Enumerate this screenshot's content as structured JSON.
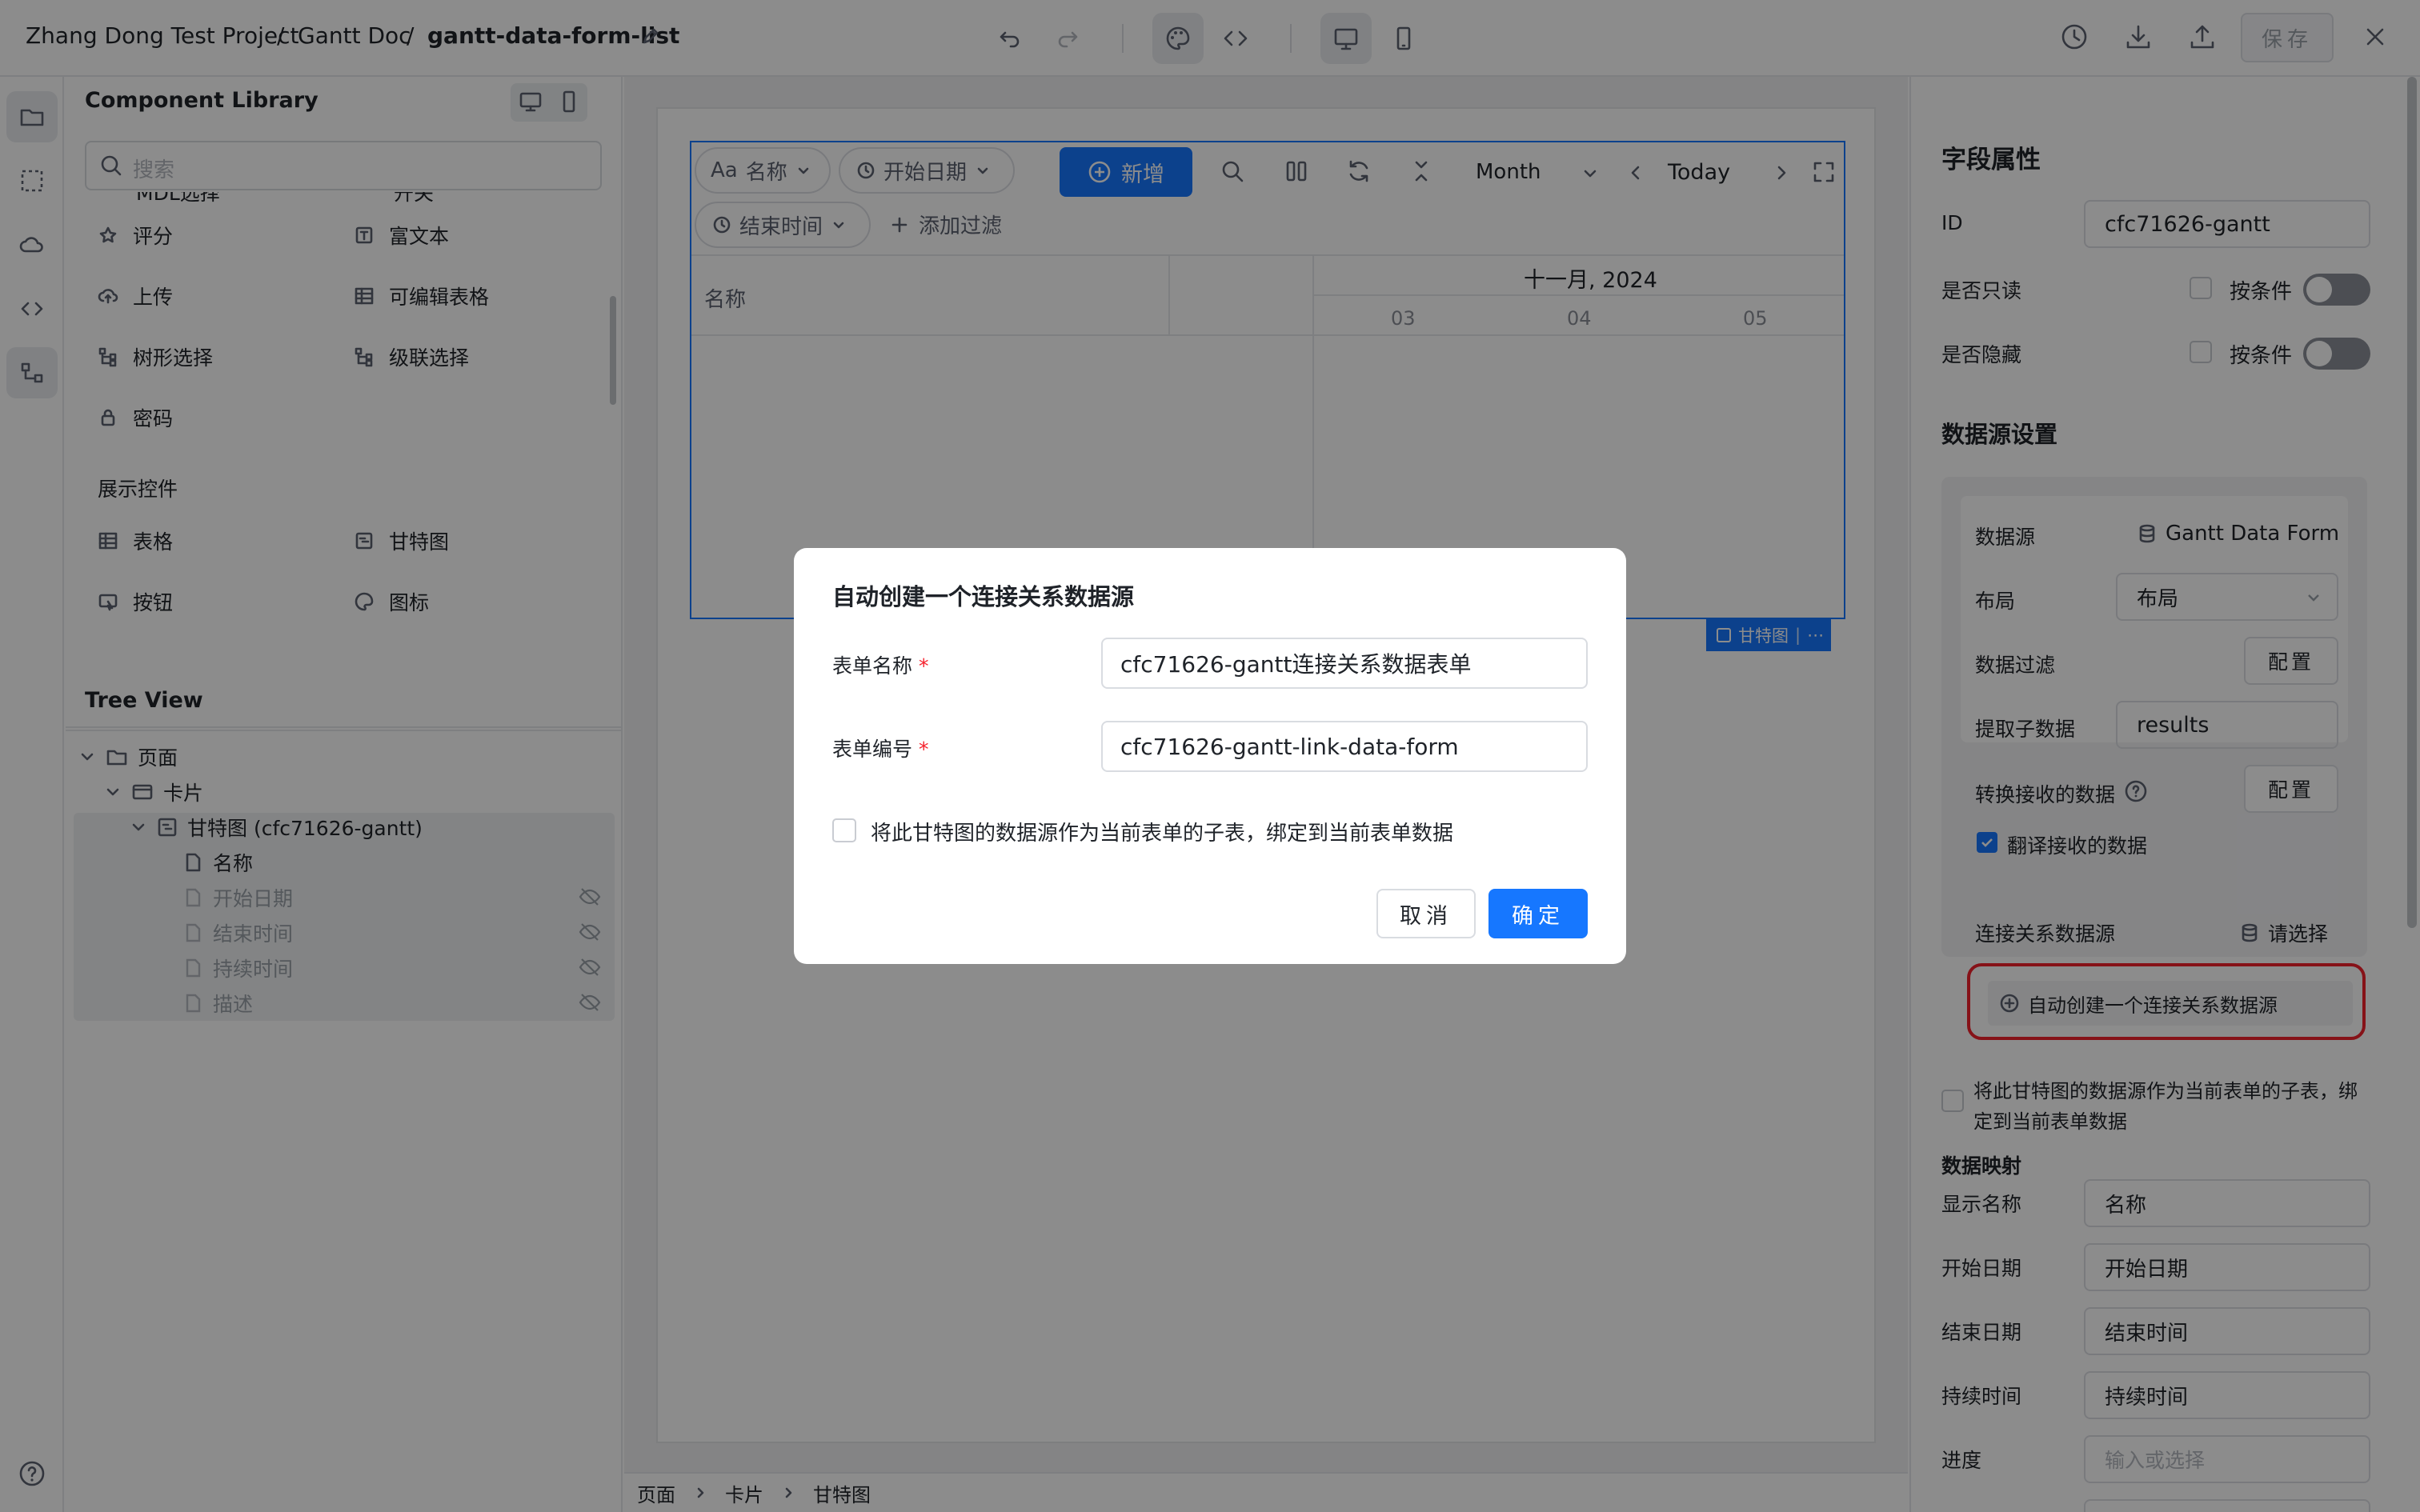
{
  "breadcrumb": {
    "project": "Zhang Dong Test Project",
    "sep1": "/",
    "doc": "Gantt Doc",
    "sep2": "/",
    "page": "gantt-data-form-list"
  },
  "toolbar": {
    "save_label": "保存"
  },
  "component_library": {
    "title": "Component Library",
    "search_placeholder": "搜索",
    "cut_left": "MDL选择",
    "cut_right": "开关",
    "items": [
      {
        "label": "评分",
        "icon": "star-icon"
      },
      {
        "label": "富文本",
        "icon": "rich-text-icon"
      },
      {
        "label": "上传",
        "icon": "upload-cloud-icon"
      },
      {
        "label": "可编辑表格",
        "icon": "table-icon"
      },
      {
        "label": "树形选择",
        "icon": "tree-select-icon"
      },
      {
        "label": "级联选择",
        "icon": "cascade-icon"
      },
      {
        "label": "密码",
        "icon": "lock-icon"
      }
    ],
    "display_section": "展示控件",
    "display_items": [
      {
        "label": "表格",
        "icon": "table-icon"
      },
      {
        "label": "甘特图",
        "icon": "gantt-icon"
      },
      {
        "label": "按钮",
        "icon": "button-icon"
      },
      {
        "label": "图标",
        "icon": "palette-icon"
      }
    ]
  },
  "tree_view": {
    "title": "Tree View",
    "nodes": [
      {
        "label": "页面"
      },
      {
        "label": "卡片"
      },
      {
        "label": "甘特图 (cfc71626-gantt)"
      },
      {
        "label": "名称"
      },
      {
        "label": "开始日期"
      },
      {
        "label": "结束时间"
      },
      {
        "label": "持续时间"
      },
      {
        "label": "描述"
      }
    ]
  },
  "gantt": {
    "filters": [
      "名称",
      "开始日期",
      "结束时间"
    ],
    "aa": "Aa",
    "add_label": "新增",
    "add_filter": "添加过滤",
    "view_mode": "Month",
    "today": "Today",
    "column_name": "名称",
    "month_header": "十一月, 2024",
    "days": [
      "03",
      "04",
      "05"
    ],
    "tag_label": "甘特图",
    "tag_more": "⋯"
  },
  "status_breadcrumb": [
    "页面",
    "卡片",
    "甘特图"
  ],
  "right_panel": {
    "field_title": "字段属性",
    "id_label": "ID",
    "id_value": "cfc71626-gantt",
    "readonly_label": "是否只读",
    "hidden_label": "是否隐藏",
    "by_condition": "按条件",
    "ds_title": "数据源设置",
    "ds_label": "数据源",
    "ds_value": "Gantt Data Form",
    "layout_label": "布局",
    "layout_value": "布局",
    "filter_label": "数据过滤",
    "config_label": "配置",
    "extract_label": "提取子数据",
    "extract_value": "results",
    "transform_label": "转换接收的数据",
    "translate_label": "翻译接收的数据",
    "link_label": "连接关系数据源",
    "link_value": "请选择",
    "auto_create": "自动创建一个连接关系数据源",
    "subtable_text_1": "将此甘特图的数据源作为当前表单的子表，绑",
    "subtable_text_2": "定到当前表单数据",
    "mapping_title": "数据映射",
    "mappings": [
      {
        "label": "显示名称",
        "value": "名称"
      },
      {
        "label": "开始日期",
        "value": "开始日期"
      },
      {
        "label": "结束日期",
        "value": "结束时间"
      },
      {
        "label": "持续时间",
        "value": "持续时间"
      }
    ],
    "progress_label": "进度",
    "progress_placeholder": "输入或选择"
  },
  "modal": {
    "title": "自动创建一个连接关系数据源",
    "form_name_label": "表单名称",
    "form_name_value": "cfc71626-gantt连接关系数据表单",
    "form_code_label": "表单编号",
    "form_code_value": "cfc71626-gantt-link-data-form",
    "required_mark": "*",
    "checkbox_label": "将此甘特图的数据源作为当前表单的子表，绑定到当前表单数据",
    "cancel": "取消",
    "ok": "确定"
  },
  "colors": {
    "primary": "#1677ff",
    "highlight_border": "#f5222d",
    "overlay": "rgba(0,0,0,0.45)"
  }
}
